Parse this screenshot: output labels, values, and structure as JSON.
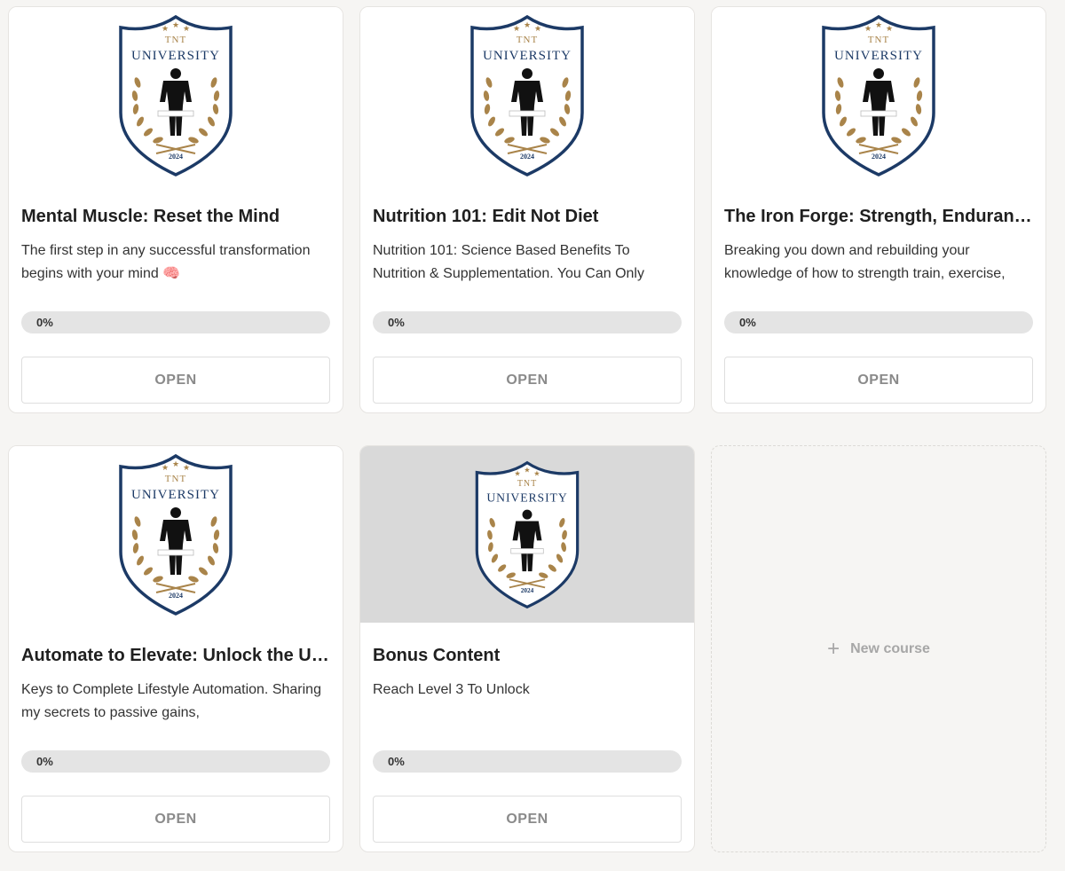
{
  "badge": {
    "line1": "TNT",
    "line2": "UNIVERSITY",
    "year": "2024"
  },
  "courses": [
    {
      "title": "Mental Muscle: Reset the Mind",
      "description": "The first step in any successful transformation begins with your mind 🧠",
      "progress_label": "0%",
      "progress": 0,
      "button": "OPEN",
      "locked": false
    },
    {
      "title": "Nutrition 101: Edit Not Diet",
      "description": "Nutrition 101: Science Based Benefits To Nutrition & Supplementation. You Can Only",
      "progress_label": "0%",
      "progress": 0,
      "button": "OPEN",
      "locked": false
    },
    {
      "title": "The Iron Forge: Strength, Enduran…",
      "description": "Breaking you down and rebuilding your knowledge of how to strength train, exercise,",
      "progress_label": "0%",
      "progress": 0,
      "button": "OPEN",
      "locked": false
    },
    {
      "title": "Automate to Elevate: Unlock the U…",
      "description": "Keys to Complete Lifestyle Automation. Sharing my secrets to passive gains,",
      "progress_label": "0%",
      "progress": 0,
      "button": "OPEN",
      "locked": false
    },
    {
      "title": "Bonus Content",
      "description": "Reach Level 3 To Unlock",
      "progress_label": "0%",
      "progress": 0,
      "button": "OPEN",
      "locked": true
    }
  ],
  "new_course": {
    "label": "New course",
    "icon": "plus-icon"
  },
  "colors": {
    "badge_navy": "#1c3a66",
    "badge_gold": "#a9844a",
    "button_text": "#8a8a8a",
    "progress_track": "#e4e4e4",
    "locked_image_bg": "#d9d9d9"
  }
}
